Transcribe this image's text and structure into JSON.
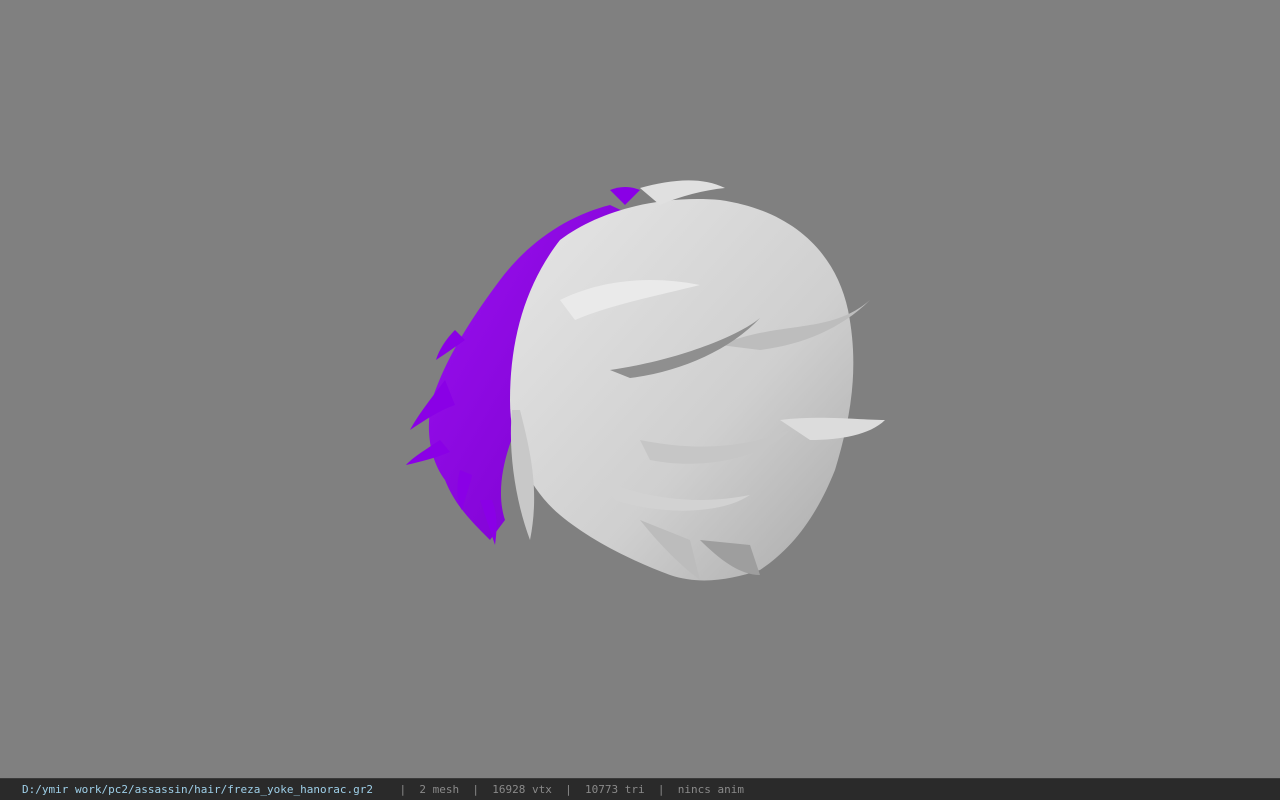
{
  "viewport": {
    "background_color": "#808080",
    "model": {
      "icon": "hair-mesh-model",
      "primary_color": "#d8d8d8",
      "selected_color": "#8a00e6"
    }
  },
  "status_bar": {
    "file_path": "D:/ymir work/pc2/assassin/hair/freza_yoke_hanorac.gr2",
    "separator": "|",
    "mesh_count": "2 mesh",
    "vertex_count": "16928 vtx",
    "triangle_count": "10773 tri",
    "anim_status": "nincs anim",
    "path_color": "#9ecfe8",
    "text_color": "#8a8a8a"
  }
}
